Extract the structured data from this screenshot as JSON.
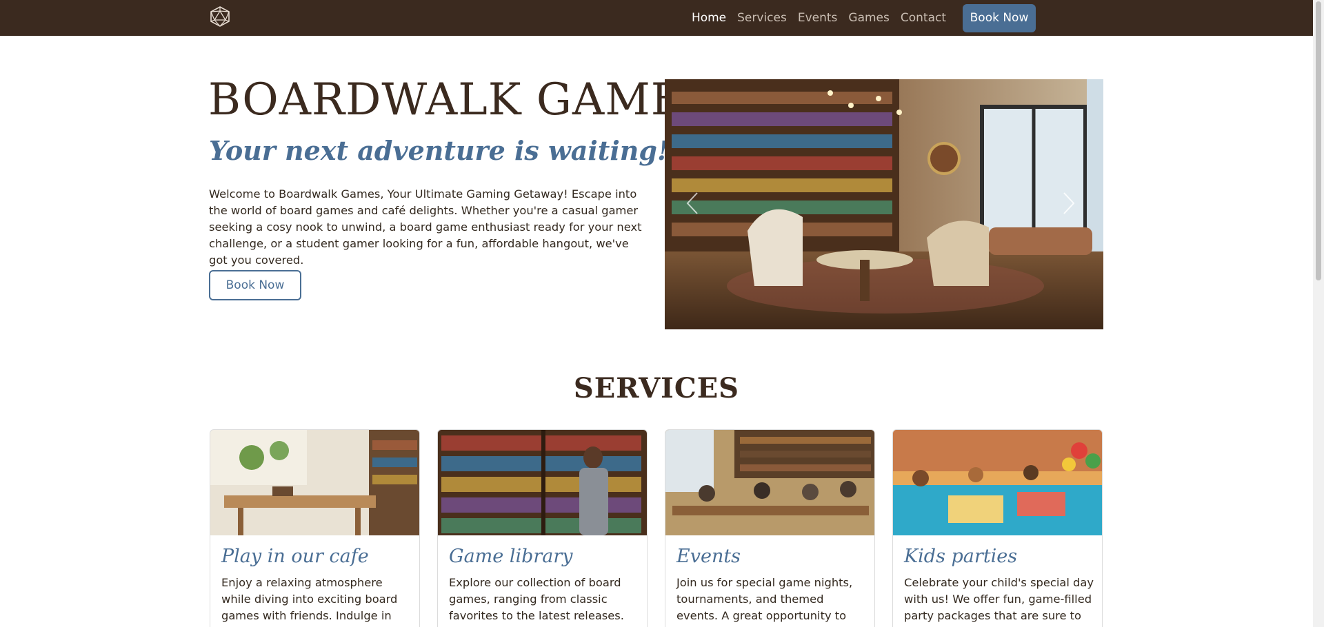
{
  "nav": {
    "logo": "d20-icon",
    "links": [
      {
        "label": "Home",
        "active": true
      },
      {
        "label": "Services",
        "active": false
      },
      {
        "label": "Events",
        "active": false
      },
      {
        "label": "Games",
        "active": false
      },
      {
        "label": "Contact",
        "active": false
      }
    ],
    "cta": "Book Now"
  },
  "hero": {
    "title": "BOARDWALK GAMES",
    "subtitle": "Your next adventure is waiting!",
    "text": "Welcome to Boardwalk Games, Your Ultimate Gaming Getaway! Escape into the world of board games and café delights. Whether you're a casual gamer seeking a cosy nook to unwind, a board game enthusiast ready for your next challenge, or a student gamer looking for a fun, affordable hangout, we've got you covered.",
    "button": "Book Now",
    "carousel": {
      "prev_icon": "chevron-left-icon",
      "next_icon": "chevron-right-icon"
    }
  },
  "services": {
    "title": "SERVICES",
    "cards": [
      {
        "title": "Play in our cafe",
        "text": "Enjoy a relaxing atmosphere while diving into exciting board games with friends. Indulge in our cosy"
      },
      {
        "title": "Game library",
        "text": "Explore our collection of board games, ranging from classic favorites to the latest releases. Find"
      },
      {
        "title": "Events",
        "text": "Join us for special game nights, tournaments, and themed events. A great opportunity to meet new"
      },
      {
        "title": "Kids parties",
        "text": "Celebrate your child's special day with us! We offer fun, game-filled party packages that are sure to"
      }
    ]
  },
  "colors": {
    "nav_bg": "#3b2a1f",
    "accent": "#4a6e94",
    "title": "#3b2a1f"
  }
}
